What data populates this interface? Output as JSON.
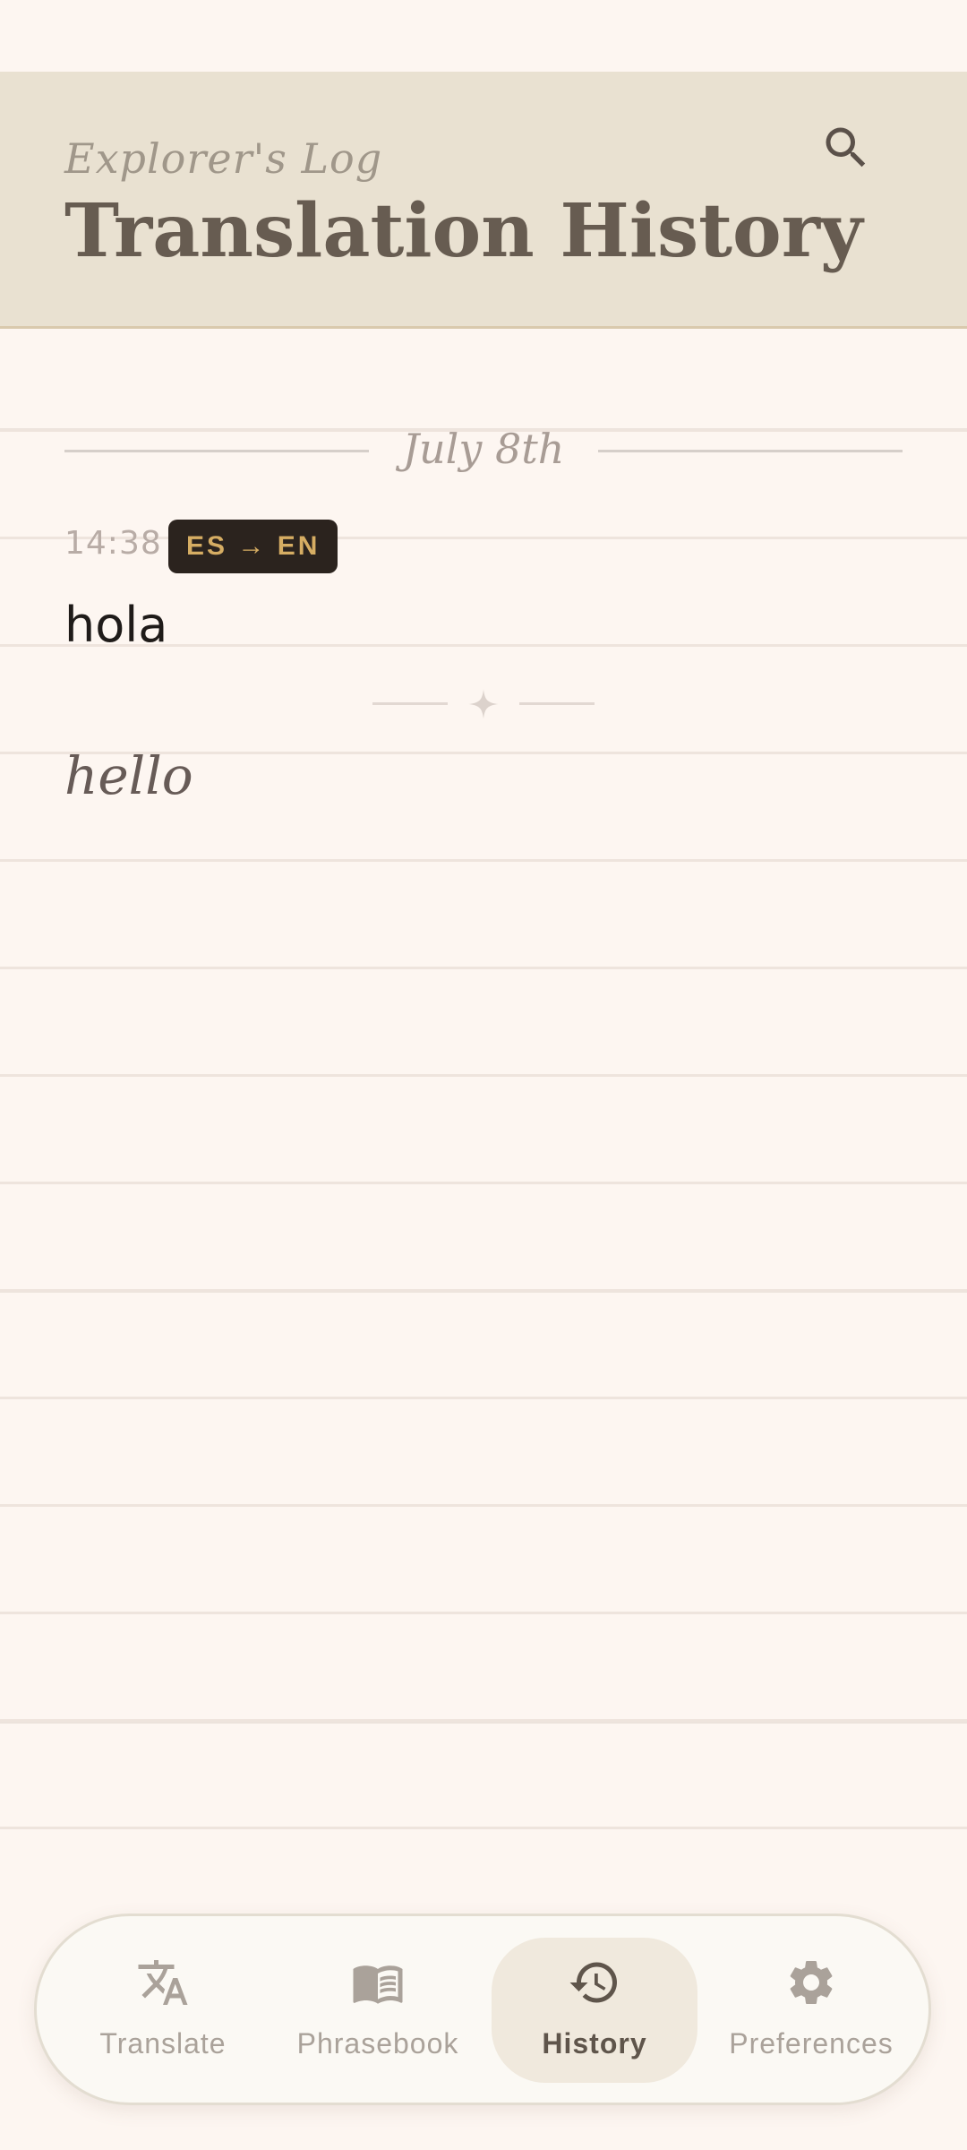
{
  "header": {
    "subtitle": "Explorer's Log",
    "title": "Translation History"
  },
  "history": {
    "date": "July 8th",
    "entries": [
      {
        "time": "14:38",
        "language_pair": "ES → EN",
        "source": "hola",
        "translation": "hello"
      }
    ]
  },
  "nav": {
    "items": [
      {
        "label": "Translate",
        "icon": "translate-icon",
        "active": false
      },
      {
        "label": "Phrasebook",
        "icon": "book-icon",
        "active": false
      },
      {
        "label": "History",
        "icon": "history-icon",
        "active": true
      },
      {
        "label": "Preferences",
        "icon": "gear-icon",
        "active": false
      }
    ]
  },
  "colors": {
    "background": "#fdf6f1",
    "header_bg": "#e9e1d1",
    "badge_bg": "#2b231e",
    "badge_text": "#d6ad63",
    "title_text": "#675c51",
    "nav_active_bg": "#f0e9dd"
  }
}
